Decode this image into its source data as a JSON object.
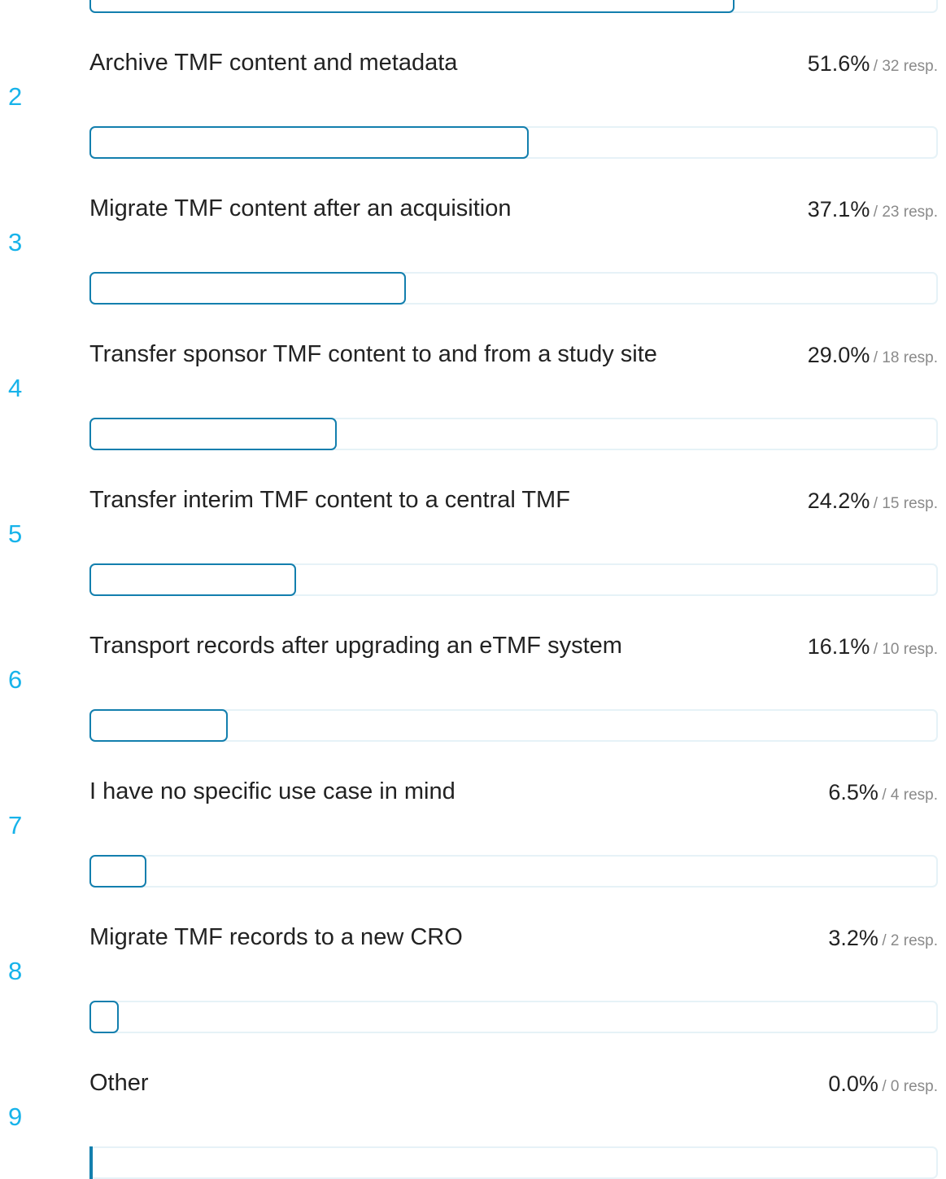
{
  "chart_data": {
    "type": "bar",
    "orientation": "horizontal",
    "items": [
      {
        "rank": "",
        "label": "",
        "pct_label": "",
        "resp_label": "",
        "value": 75.8,
        "partially_visible": true
      },
      {
        "rank": "2",
        "label": "Archive TMF content and metadata",
        "pct_label": "51.6%",
        "resp_label": "/ 32 resp.",
        "value": 51.6
      },
      {
        "rank": "3",
        "label": "Migrate TMF content after an acquisition",
        "pct_label": "37.1%",
        "resp_label": "/ 23 resp.",
        "value": 37.1
      },
      {
        "rank": "4",
        "label": "Transfer sponsor TMF content to and from a study site",
        "pct_label": "29.0%",
        "resp_label": "/ 18 resp.",
        "value": 29.0
      },
      {
        "rank": "5",
        "label": "Transfer interim TMF content to a central TMF",
        "pct_label": "24.2%",
        "resp_label": "/ 15 resp.",
        "value": 24.2
      },
      {
        "rank": "6",
        "label": "Transport records after upgrading an eTMF system",
        "pct_label": "16.1%",
        "resp_label": "/ 10 resp.",
        "value": 16.1
      },
      {
        "rank": "7",
        "label": "I have no specific use case in mind",
        "pct_label": "6.5%",
        "resp_label": "/ 4 resp.",
        "value": 6.5
      },
      {
        "rank": "8",
        "label": "Migrate TMF records to a new CRO",
        "pct_label": "3.2%",
        "resp_label": "/ 2 resp.",
        "value": 3.2
      },
      {
        "rank": "9",
        "label": "Other",
        "pct_label": "0.0%",
        "resp_label": "/ 0 resp.",
        "value": 0.0
      }
    ],
    "xlim": [
      0,
      100
    ],
    "colors": {
      "rank": "#17b3ea",
      "bar_outline": "#137fae",
      "track_outline": "#e6f2f7"
    }
  }
}
